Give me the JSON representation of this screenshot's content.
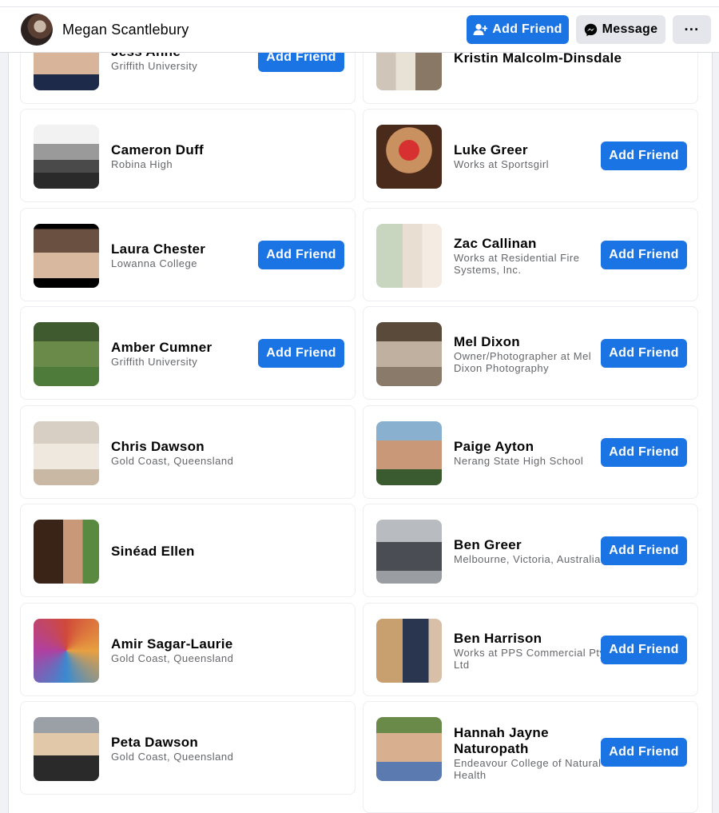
{
  "header": {
    "profile_name": "Megan Scantlebury",
    "add_friend_label": "Add Friend",
    "message_label": "Message",
    "more_label": "···"
  },
  "people": [
    {
      "name": "Jess Anne",
      "sub": "Griffith University",
      "button": "Add Friend"
    },
    {
      "name": "Kristin Malcolm-Dinsdale",
      "sub": "",
      "button": ""
    },
    {
      "name": "Cameron Duff",
      "sub": "Robina High",
      "button": ""
    },
    {
      "name": "Luke Greer",
      "sub": "Works at Sportsgirl",
      "button": "Add Friend"
    },
    {
      "name": "Laura Chester",
      "sub": "Lowanna College",
      "button": "Add Friend"
    },
    {
      "name": "Zac Callinan",
      "sub": "Works at Residential Fire Systems, Inc.",
      "button": "Add Friend"
    },
    {
      "name": "Amber Cumner",
      "sub": "Griffith University",
      "button": "Add Friend"
    },
    {
      "name": "Mel Dixon",
      "sub": "Owner/Photographer at Mel Dixon Photography",
      "button": "Add Friend"
    },
    {
      "name": "Chris Dawson",
      "sub": "Gold Coast, Queensland",
      "button": ""
    },
    {
      "name": "Paige Ayton",
      "sub": "Nerang State High School",
      "button": "Add Friend"
    },
    {
      "name": "Sinéad Ellen",
      "sub": "",
      "button": ""
    },
    {
      "name": "Ben Greer",
      "sub": "Melbourne, Victoria, Australia",
      "button": "Add Friend"
    },
    {
      "name": "Amir Sagar-Laurie",
      "sub": "Gold Coast, Queensland",
      "button": ""
    },
    {
      "name": "Ben Harrison",
      "sub": "Works at PPS Commercial Pty Ltd",
      "button": "Add Friend"
    },
    {
      "name": "Peta Dawson",
      "sub": "Gold Coast, Queensland",
      "button": ""
    },
    {
      "name": "Hannah Jayne Naturopath",
      "sub": "Endeavour College of Natural Health",
      "button": "Add Friend"
    }
  ],
  "colors": {
    "primary_button": "#1b74e4",
    "secondary_button": "#e4e6eb",
    "page_background": "#f0f2f5",
    "secondary_text": "#65676b"
  },
  "icons": {
    "add_friend": "person-plus-icon",
    "message": "messenger-icon",
    "more": "more-horizontal-icon"
  }
}
